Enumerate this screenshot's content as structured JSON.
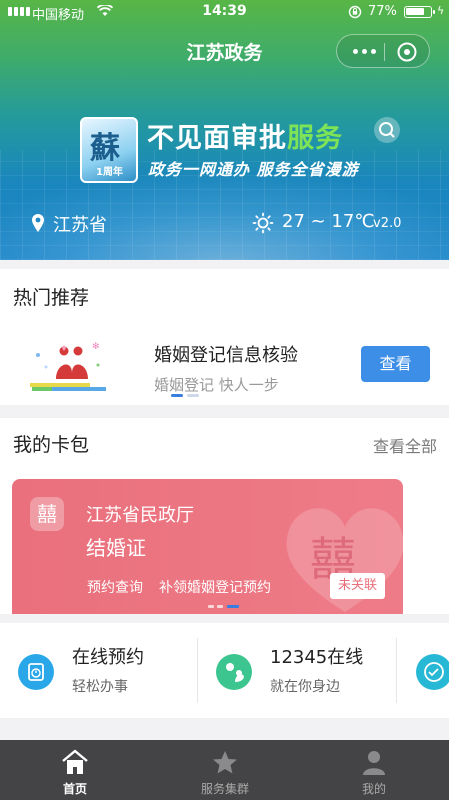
{
  "status_bar": {
    "carrier": "中国移动",
    "time": "14:39",
    "battery_text": "77%",
    "battery_level": 0.77
  },
  "nav": {
    "title": "江苏政务",
    "more_icon": "more-dots-icon",
    "close_icon": "close-circle-icon"
  },
  "banner": {
    "logo_glyph": "蘇",
    "logo_caption": "1周年",
    "title_main": "不见面审批",
    "title_highlight": "服务",
    "subtitle": "政务一网通办 服务全省漫游",
    "location": "江苏省",
    "weather": "27 ~ 17℃",
    "version": "v2.0"
  },
  "hot": {
    "title": "热门推荐",
    "item_name": "婚姻登记信息核验",
    "item_desc": "婚姻登记  快人一步",
    "button": "查看"
  },
  "wallet": {
    "title": "我的卡包",
    "view_all": "查看全部",
    "card": {
      "icon_glyph": "囍",
      "org": "江苏省民政厅",
      "name": "结婚证",
      "link_1": "预约查询",
      "link_2": "补领婚姻登记预约",
      "badge": "未关联",
      "watermark": "囍"
    }
  },
  "quick": [
    {
      "title": "在线预约",
      "sub": "轻松办事",
      "icon": "appointment-icon",
      "color": "#2aa7e8"
    },
    {
      "title": "12345在线",
      "sub": "就在你身边",
      "icon": "hotline-icon",
      "color": "#3cc58e"
    },
    {
      "title": "",
      "sub": "",
      "icon": "service-icon",
      "color": "#27b8d6"
    }
  ],
  "tabs": [
    {
      "label": "首页",
      "icon": "home-icon",
      "active": true
    },
    {
      "label": "服务集群",
      "icon": "star-icon",
      "active": false
    },
    {
      "label": "我的",
      "icon": "user-icon",
      "active": false
    }
  ],
  "colors": {
    "accent_blue": "#3c8ee6",
    "card_pink": "#e9707c",
    "highlight_green": "#7ee356",
    "tabbar_bg": "#444446"
  }
}
